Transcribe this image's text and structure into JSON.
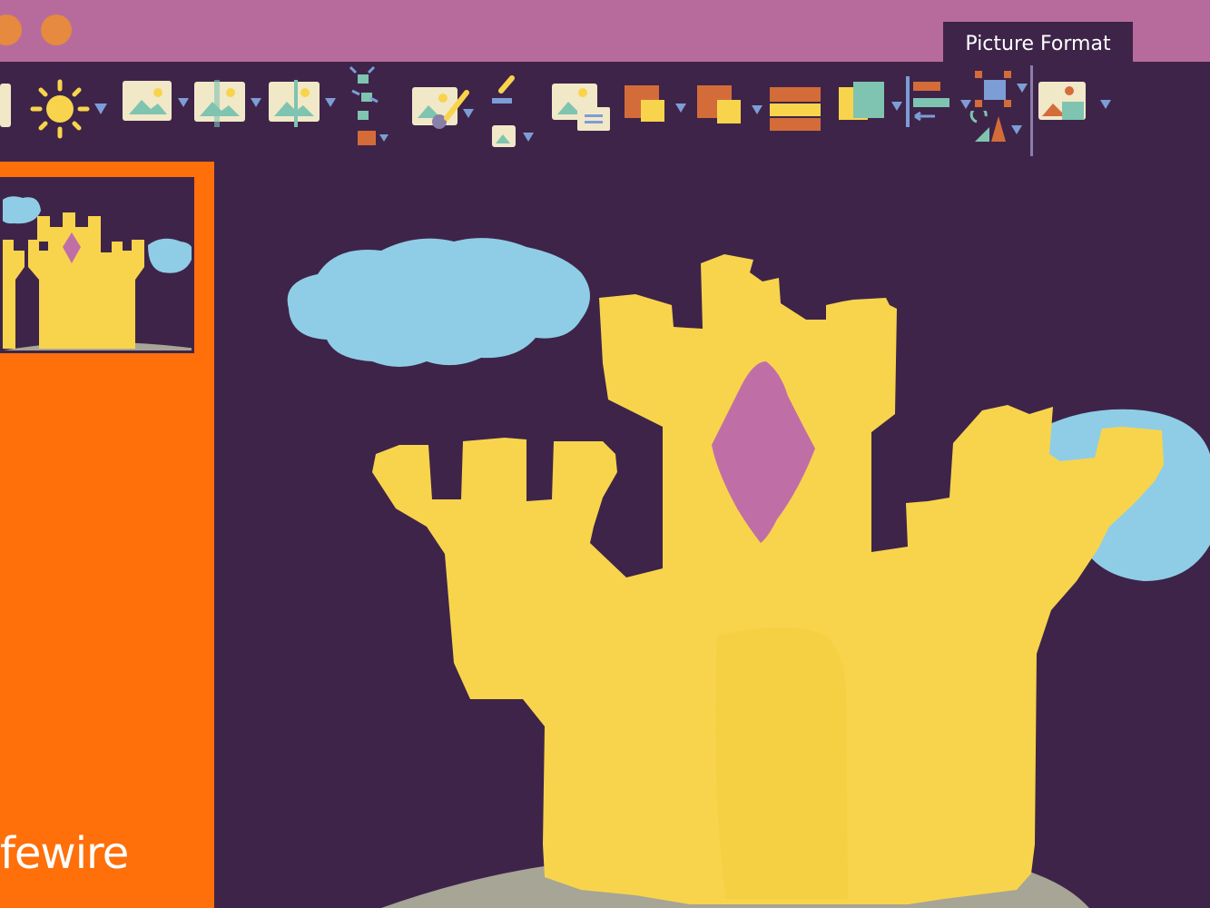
{
  "ribbon": {
    "active_tab_label": "Picture Format"
  },
  "toolbar": {
    "tools": [
      "remove-background-icon",
      "corrections-icon",
      "color-icon",
      "artistic-effects-icon",
      "transparency-icon",
      "compress-pictures-icon",
      "change-picture-icon",
      "reset-picture-icon",
      "picture-styles-icon",
      "picture-border-icon",
      "picture-effects-icon",
      "picture-layout-icon",
      "alt-text-icon",
      "bring-forward-icon",
      "send-backward-icon",
      "selection-pane-icon",
      "align-icon",
      "group-icon",
      "rotate-icon",
      "crop-icon",
      "size-icon"
    ]
  },
  "slide": {
    "image_subject": "castle-graphic"
  },
  "brand": {
    "text": "fewire"
  },
  "colors": {
    "title_bar": "#b76b9c",
    "ribbon_bg": "#3e2449",
    "slide_panel": "#ff6f0a",
    "castle": "#f8d44c",
    "gem": "#c06fa6",
    "cloud": "#8fcde6",
    "ground": "#a6a596"
  }
}
